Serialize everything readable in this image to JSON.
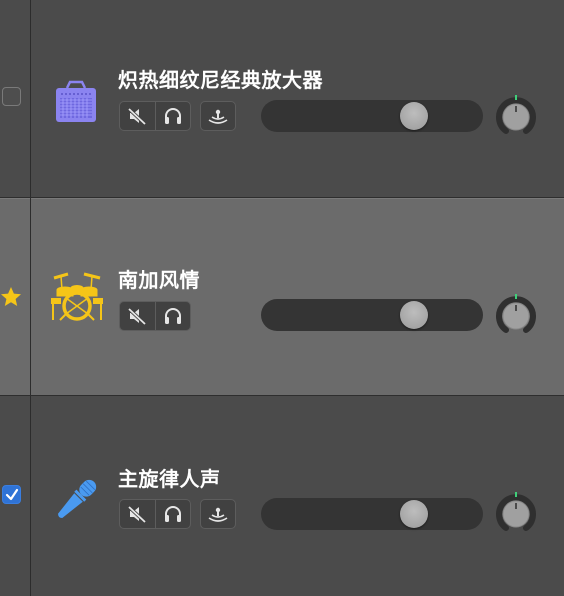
{
  "tracks": [
    {
      "name": "炽热细纹尼经典放大器",
      "icon": "amplifier-icon",
      "header_control": "checkbox-unchecked",
      "selected": false,
      "mute_icon": "speaker-muted-icon",
      "solo_icon": "headphones-icon",
      "input_monitor_icon": "input-monitor-icon",
      "volume": 0.72,
      "accent_color": "#8b84f0"
    },
    {
      "name": "南加风情",
      "icon": "drum-kit-icon",
      "header_control": "star",
      "selected": true,
      "mute_icon": "speaker-muted-icon",
      "solo_icon": "headphones-icon",
      "volume": 0.72,
      "accent_color": "#f5c518"
    },
    {
      "name": "主旋律人声",
      "icon": "microphone-icon",
      "header_control": "checkbox-checked",
      "selected": false,
      "mute_icon": "speaker-muted-icon",
      "solo_icon": "headphones-icon",
      "input_monitor_icon": "input-monitor-icon",
      "volume": 0.72,
      "accent_color": "#4a9af0"
    }
  ]
}
